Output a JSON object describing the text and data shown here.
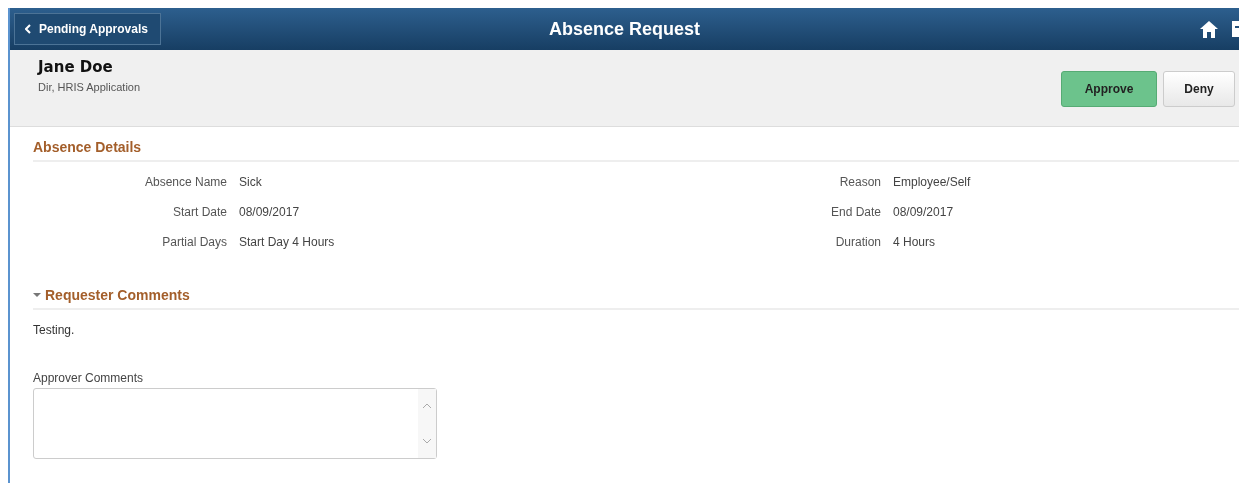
{
  "header": {
    "back_label": "Pending Approvals",
    "title": "Absence Request"
  },
  "employee": {
    "name": "Jane Doe",
    "job_title": "Dir, HRIS Application"
  },
  "actions": [
    {
      "label": "Approve",
      "kind": "primary"
    },
    {
      "label": "Deny",
      "kind": "secondary"
    }
  ],
  "absence_details": {
    "heading": "Absence Details",
    "left_fields": [
      {
        "label": "Absence Name",
        "value": "Sick"
      },
      {
        "label": "Start Date",
        "value": "08/09/2017"
      },
      {
        "label": "Partial Days",
        "value": "Start Day 4 Hours"
      }
    ],
    "right_fields": [
      {
        "label": "Reason",
        "value": "Employee/Self"
      },
      {
        "label": "End Date",
        "value": "08/09/2017"
      },
      {
        "label": "Duration",
        "value": "4 Hours"
      }
    ]
  },
  "requester_comments": {
    "heading": "Requester Comments",
    "expanded": true,
    "text": "Testing."
  },
  "approver_comments": {
    "label": "Approver Comments"
  }
}
